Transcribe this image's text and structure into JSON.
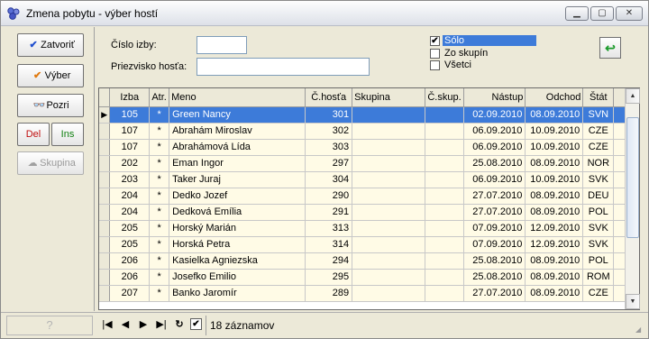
{
  "window": {
    "title": "Zmena pobytu - výber hostí",
    "min_glyph": "▁",
    "max_glyph": "▢",
    "close_glyph": "✕"
  },
  "toolbar": {
    "zatvorit_label": "Zatvoriť",
    "vyber_label": "Výber",
    "pozri_label": "Pozri",
    "del_label": "Del",
    "ins_label": "Ins",
    "skupina_label": "Skupina"
  },
  "form": {
    "room_label": "Číslo izby:",
    "room_value": "",
    "surname_label": "Priezvisko hosťa:",
    "surname_value": ""
  },
  "filters": [
    {
      "label": "Sólo",
      "checked": true,
      "selected": true,
      "mark": "✔"
    },
    {
      "label": "Zo skupín",
      "checked": false,
      "selected": false,
      "mark": ""
    },
    {
      "label": "Všetci",
      "checked": false,
      "selected": false,
      "mark": ""
    }
  ],
  "grid": {
    "columns": [
      "Izba",
      "Atr.",
      "Meno",
      "Č.hosťa",
      "Skupina",
      "Č.skup.",
      "Nástup",
      "Odchod",
      "Štát"
    ],
    "current_row_marker": "▶",
    "rows": [
      [
        "105",
        "*",
        "Green Nancy",
        "301",
        "",
        "",
        "02.09.2010",
        "08.09.2010",
        "SVN"
      ],
      [
        "107",
        "*",
        "Abrahám Miroslav",
        "302",
        "",
        "",
        "06.09.2010",
        "10.09.2010",
        "CZE"
      ],
      [
        "107",
        "*",
        "Abrahámová Lída",
        "303",
        "",
        "",
        "06.09.2010",
        "10.09.2010",
        "CZE"
      ],
      [
        "202",
        "*",
        "Eman Ingor",
        "297",
        "",
        "",
        "25.08.2010",
        "08.09.2010",
        "NOR"
      ],
      [
        "203",
        "*",
        "Taker Juraj",
        "304",
        "",
        "",
        "06.09.2010",
        "10.09.2010",
        "SVK"
      ],
      [
        "204",
        "*",
        "Dedko Jozef",
        "290",
        "",
        "",
        "27.07.2010",
        "08.09.2010",
        "DEU"
      ],
      [
        "204",
        "*",
        "Dedková Emília",
        "291",
        "",
        "",
        "27.07.2010",
        "08.09.2010",
        "POL"
      ],
      [
        "205",
        "*",
        "Horský Marián",
        "313",
        "",
        "",
        "07.09.2010",
        "12.09.2010",
        "SVK"
      ],
      [
        "205",
        "*",
        "Horská Petra",
        "314",
        "",
        "",
        "07.09.2010",
        "12.09.2010",
        "SVK"
      ],
      [
        "206",
        "*",
        "Kasielka Agniezska",
        "294",
        "",
        "",
        "25.08.2010",
        "08.09.2010",
        "POL"
      ],
      [
        "206",
        "*",
        "Josefko Emilio",
        "295",
        "",
        "",
        "25.08.2010",
        "08.09.2010",
        "ROM"
      ],
      [
        "207",
        "*",
        "Banko Jaromír",
        "289",
        "",
        "",
        "27.07.2010",
        "08.09.2010",
        "CZE"
      ]
    ]
  },
  "statusbar": {
    "help_glyph": "?",
    "first_glyph": "|◀",
    "prev_glyph": "◀",
    "next_glyph": "▶",
    "last_glyph": "▶|",
    "refresh_glyph": "↻",
    "check_mark": "✔",
    "records_text": "18 záznamov"
  },
  "colors": {
    "selection": "#3d7bd9",
    "row_bg": "#fffbe6",
    "panel_bg": "#ece9d8"
  }
}
